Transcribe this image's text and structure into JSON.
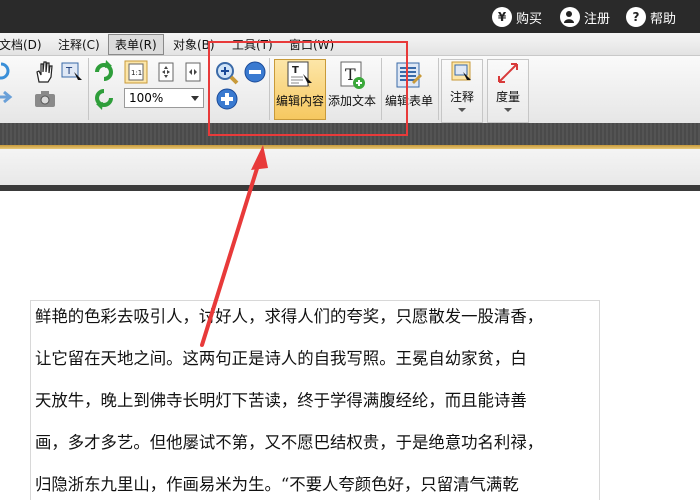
{
  "topbar": {
    "buy": {
      "icon": "¥",
      "label": "购买"
    },
    "register": {
      "icon": "",
      "label": "注册"
    },
    "help": {
      "icon": "?",
      "label": "帮助"
    }
  },
  "menu": {
    "items": [
      "文档(D)",
      "注释(C)",
      "表单(R)",
      "对象(B)",
      "工具(T)",
      "窗口(W)"
    ],
    "active_index": 2
  },
  "toolbar": {
    "zoom_value": "100%",
    "edit_content": "编辑内容",
    "add_text": "添加文本",
    "edit_form": "编辑表单",
    "annotate": "注释",
    "measure": "度量"
  },
  "document": {
    "lines": [
      "鲜艳的色彩去吸引人，讨好人，求得人们的夸奖，只愿散发一股清香，",
      "让它留在天地之间。这两句正是诗人的自我写照。王冕自幼家贫，白",
      "天放牛，晚上到佛寺长明灯下苦读，终于学得满腹经纶，而且能诗善",
      "画，多才多艺。但他屡试不第，又不愿巴结权贵，于是绝意功名利禄，",
      "归隐浙东九里山，作画易米为生。“不要人夸颜色好，只留清气满乾"
    ]
  },
  "colors": {
    "highlight": "#e83a3a",
    "active_tool": "#f6c860"
  }
}
